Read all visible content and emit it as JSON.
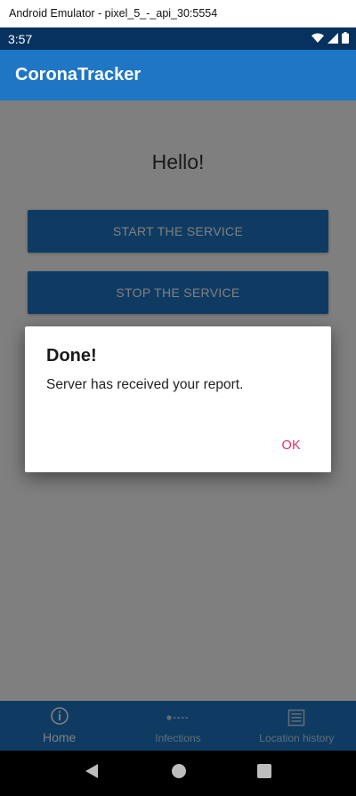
{
  "emulator": {
    "title": "Android Emulator - pixel_5_-_api_30:5554"
  },
  "status_bar": {
    "time": "3:57",
    "icons": [
      "wifi-icon",
      "signal-icon",
      "battery-icon"
    ]
  },
  "app_bar": {
    "title": "CoronaTracker"
  },
  "main": {
    "greeting": "Hello!",
    "start_button": "START THE SERVICE",
    "stop_button": "STOP THE SERVICE"
  },
  "dialog": {
    "title": "Done!",
    "message": "Server has received your report.",
    "ok_label": "OK"
  },
  "bottom_nav": {
    "items": [
      {
        "label": "Home",
        "icon": "info-icon",
        "active": true
      },
      {
        "label": "Infections",
        "icon": "dots-line-icon",
        "active": false
      },
      {
        "label": "Location history",
        "icon": "list-document-icon",
        "active": false
      }
    ]
  },
  "colors": {
    "status_bar": "#07325f",
    "primary": "#1f76c4",
    "dialog_accent": "#e0306b",
    "scrim": "rgba(0,0,0,0.5)"
  }
}
